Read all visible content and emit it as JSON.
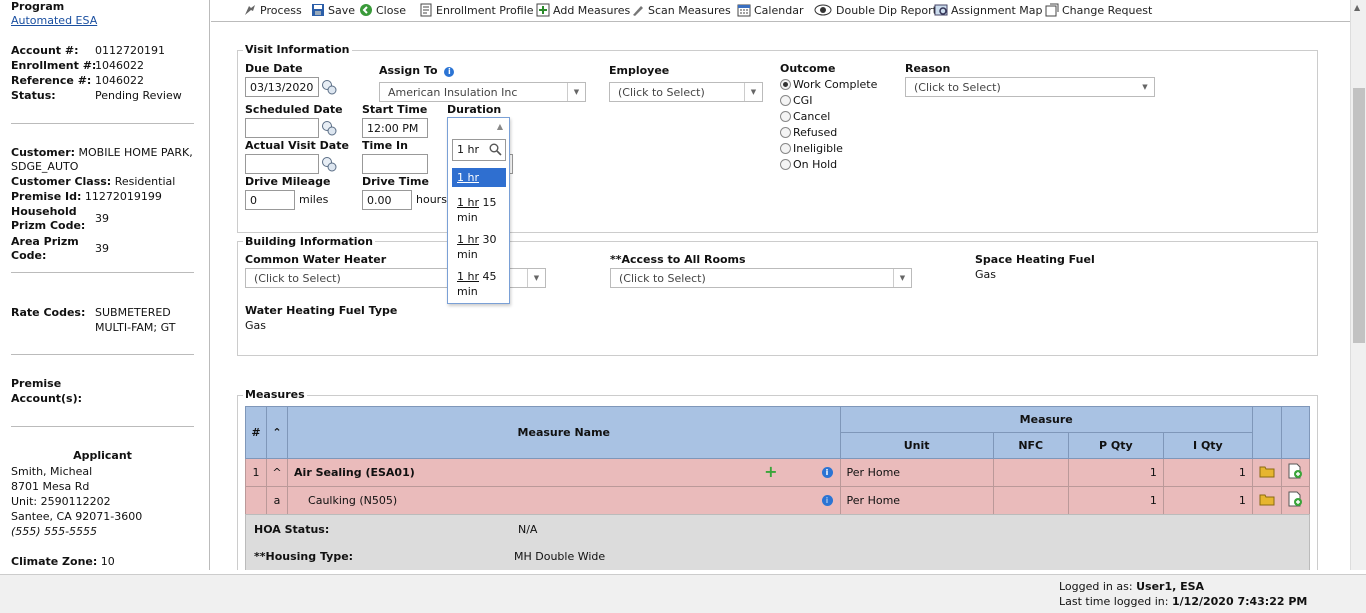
{
  "sidebar": {
    "program_label": "Program",
    "program_value": "Automated ESA",
    "account_label": "Account #:",
    "account_value": "0112720191",
    "enrollment_label": "Enrollment #:",
    "enrollment_value": "1046022",
    "reference_label": "Reference #:",
    "reference_value": "1046022",
    "status_label": "Status:",
    "status_value": "Pending Review",
    "customer_label": "Customer:",
    "customer_value_1": "MOBILE HOME PARK,",
    "customer_value_2": "SDGE_AUTO",
    "customer_class_label": "Customer Class:",
    "customer_class_value": "Residential",
    "premise_id_label": "Premise Id:",
    "premise_id_value": "11272019199",
    "household_label_1": "Household",
    "household_label_2": "Prizm Code:",
    "household_value": "39",
    "area_label_1": "Area Prizm",
    "area_label_2": "Code:",
    "area_value": "39",
    "rate_codes_label": "Rate Codes:",
    "rate_codes_value_1": "SUBMETERED",
    "rate_codes_value_2": "MULTI-FAM; GT",
    "premise_accounts_label_1": "Premise",
    "premise_accounts_label_2": "Account(s):",
    "applicant_title": "Applicant",
    "applicant_name": "Smith, Micheal",
    "applicant_address": "8701 Mesa Rd",
    "applicant_unit": "Unit: 2590112202",
    "applicant_city": "Santee, CA 92071-3600",
    "applicant_phone": "(555) 555-5555",
    "climate_zone_label": "Climate Zone:",
    "climate_zone_value": "10"
  },
  "toolbar": {
    "process": "Process",
    "save": "Save",
    "close": "Close",
    "enrollment_profile": "Enrollment Profile",
    "add_measures": "Add Measures",
    "scan_measures": "Scan Measures",
    "calendar": "Calendar",
    "double_dip_report": "Double Dip Report",
    "assignment_map": "Assignment Map",
    "change_request": "Change Request"
  },
  "visit": {
    "section_title": "Visit Information",
    "due_date_label": "Due Date",
    "due_date_value": "03/13/2020",
    "assign_to_label": "Assign To",
    "assign_to_value": "American Insulation Inc",
    "employee_label": "Employee",
    "employee_value": "(Click to Select)",
    "outcome_label": "Outcome",
    "reason_label": "Reason",
    "reason_value": "(Click to Select)",
    "scheduled_date_label": "Scheduled Date",
    "start_time_label": "Start Time",
    "start_time_value": "12:00 PM",
    "duration_label": "Duration",
    "actual_visit_date_label": "Actual Visit Date",
    "time_in_label": "Time In",
    "drive_mileage_label": "Drive Mileage",
    "drive_mileage_value": "0",
    "miles_unit": "miles",
    "drive_time_label": "Drive Time",
    "drive_time_value": "0.00",
    "hours_unit": "hours",
    "outcome_options": [
      "Work Complete",
      "CGI",
      "Cancel",
      "Refused",
      "Ineligible",
      "On Hold"
    ],
    "outcome_selected": 0
  },
  "duration_dropdown": {
    "search_value": "1 hr",
    "options": [
      {
        "a": "1 hr",
        "b": ""
      },
      {
        "a": "1 hr",
        "b": " 15",
        "c": "min"
      },
      {
        "a": "1 hr",
        "b": " 30",
        "c": "min"
      },
      {
        "a": "1 hr",
        "b": " 45",
        "c": "min"
      }
    ]
  },
  "building": {
    "section_title": "Building Information",
    "common_water_heater_label": "Common Water Heater",
    "common_water_heater_value": "(Click to Select)",
    "access_rooms_label": "**Access to All Rooms",
    "access_rooms_value": "(Click to Select)",
    "space_heating_label": "Space Heating Fuel",
    "space_heating_value": "Gas",
    "water_heating_label": "Water Heating Fuel Type",
    "water_heating_value": "Gas"
  },
  "measures": {
    "section_title": "Measures",
    "col_num": "#",
    "col_name": "Measure Name",
    "col_group": "Measure",
    "col_unit": "Unit",
    "col_nfc": "NFC",
    "col_pqty": "P Qty",
    "col_iqty": "I Qty",
    "rows": [
      {
        "num": "1",
        "toggle": "^",
        "name": "Air Sealing (ESA01)",
        "unit": "Per Home",
        "nfc": "",
        "pqty": "1",
        "iqty": "1"
      },
      {
        "num": "",
        "toggle": "a",
        "name": "Caulking (N505)",
        "unit": "Per Home",
        "nfc": "",
        "pqty": "1",
        "iqty": "1"
      }
    ],
    "hoa_label": "HOA Status:",
    "hoa_value": "N/A",
    "housing_label": "**Housing Type:",
    "housing_value": "MH Double Wide"
  },
  "status": {
    "logged_in_label": "Logged in as:",
    "logged_in_value": "User1, ESA",
    "last_login_label": "Last time logged in:",
    "last_login_value": "1/12/2020 7:43:22 PM"
  }
}
